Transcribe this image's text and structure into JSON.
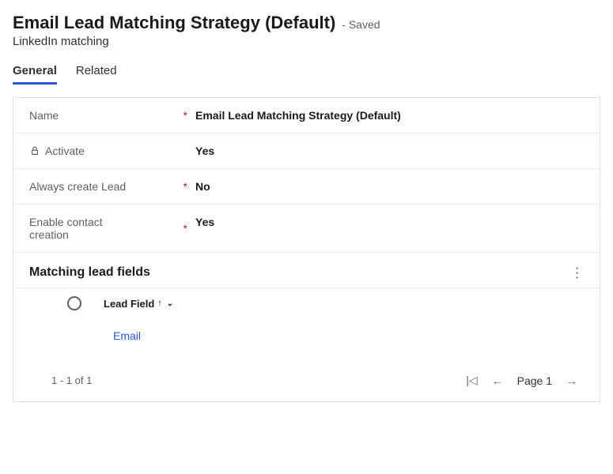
{
  "header": {
    "title": "Email Lead Matching Strategy (Default)",
    "saveStatus": "- Saved",
    "subtitle": "LinkedIn matching"
  },
  "tabs": {
    "general": "General",
    "related": "Related"
  },
  "fields": {
    "name": {
      "label": "Name",
      "value": "Email Lead Matching Strategy (Default)",
      "required": "*"
    },
    "activate": {
      "label": "Activate",
      "value": "Yes"
    },
    "alwaysCreateLead": {
      "label": "Always create Lead",
      "value": "No",
      "required": "*"
    },
    "enableContactCreation": {
      "label": "Enable contact creation",
      "value": "Yes",
      "required": "*"
    }
  },
  "section": {
    "title": "Matching lead fields"
  },
  "grid": {
    "columnHeader": "Lead Field",
    "sortGlyph": "↑",
    "chevron": "⌄",
    "rows": [
      {
        "value": "Email"
      }
    ]
  },
  "pager": {
    "count": "1 - 1 of 1",
    "first": "|◁",
    "prev": "←",
    "pageLabel": "Page 1",
    "next": "→"
  }
}
